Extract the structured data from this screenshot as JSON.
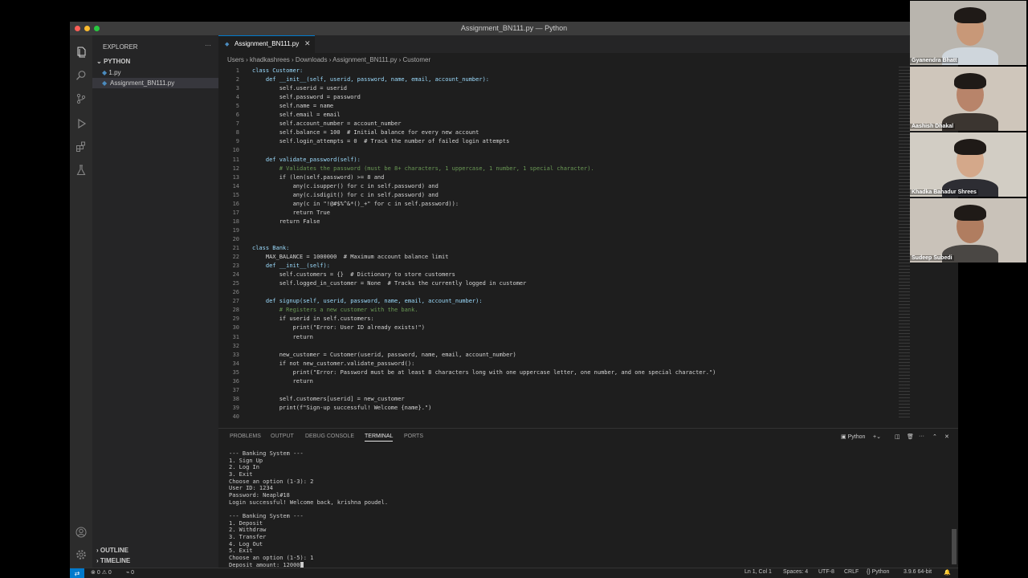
{
  "window": {
    "title": "Assignment_BN111.py — Python",
    "colors": {
      "close": "#ff5f57",
      "minimize": "#febc2e",
      "maximize": "#28c840",
      "accent": "#007acc"
    }
  },
  "sidebar": {
    "header": "EXPLORER",
    "more": "···",
    "folder": "PYTHON",
    "files": [
      "1.py",
      "Assignment_BN111.py"
    ],
    "outline": "OUTLINE",
    "timeline": "TIMELINE"
  },
  "editor": {
    "tab": "Assignment_BN111.py",
    "breadcrumb": [
      "Users",
      "khadkashrees",
      "Downloads",
      "Assignment_BN111.py",
      "Customer"
    ],
    "lines": [
      "class Customer:",
      "    def __init__(self, userid, password, name, email, account_number):",
      "        self.userid = userid",
      "        self.password = password",
      "        self.name = name",
      "        self.email = email",
      "        self.account_number = account_number",
      "        self.balance = 100  # Initial balance for every new account",
      "        self.login_attempts = 0  # Track the number of failed login attempts",
      "",
      "    def validate_password(self):",
      "        # Validates the password (must be 8+ characters, 1 uppercase, 1 number, 1 special character).",
      "        if (len(self.password) >= 8 and",
      "            any(c.isupper() for c in self.password) and",
      "            any(c.isdigit() for c in self.password) and",
      "            any(c in \"!@#$%^&*()_+\" for c in self.password)):",
      "            return True",
      "        return False",
      "",
      "",
      "class Bank:",
      "    MAX_BALANCE = 1000000  # Maximum account balance limit",
      "    def __init__(self):",
      "        self.customers = {}  # Dictionary to store customers",
      "        self.logged_in_customer = None  # Tracks the currently logged in customer",
      "",
      "    def signup(self, userid, password, name, email, account_number):",
      "        # Registers a new customer with the bank.",
      "        if userid in self.customers:",
      "            print(\"Error: User ID already exists!\")",
      "            return",
      "",
      "        new_customer = Customer(userid, password, name, email, account_number)",
      "        if not new_customer.validate_password():",
      "            print(\"Error: Password must be at least 8 characters long with one uppercase letter, one number, and one special character.\")",
      "            return",
      "",
      "        self.customers[userid] = new_customer",
      "        print(f\"Sign-up successful! Welcome {name}.\")",
      ""
    ]
  },
  "panel": {
    "tabs": [
      "PROBLEMS",
      "OUTPUT",
      "DEBUG CONSOLE",
      "TERMINAL",
      "PORTS"
    ],
    "active_tab": "TERMINAL",
    "shell": "Python",
    "terminal_lines": [
      "--- Banking System ---",
      "1. Sign Up",
      "2. Log In",
      "3. Exit",
      "Choose an option (1-3): 2",
      "User ID: 1234",
      "Password: Neapl#18",
      "Login successful! Welcome back, krishna poudel.",
      "",
      "--- Banking System ---",
      "1. Deposit",
      "2. Withdraw",
      "3. Transfer",
      "4. Log Out",
      "5. Exit",
      "Choose an option (1-5): 1",
      "Deposit amount: 12000"
    ]
  },
  "statusbar": {
    "errors": "0",
    "warnings": "0",
    "ports": "0",
    "position": "Ln 1, Col 1",
    "spaces": "Spaces: 4",
    "encoding": "UTF-8",
    "eol": "CRLF",
    "language": "Python",
    "interpreter": "3.9.6 64-bit"
  },
  "participants": [
    {
      "name": "Gyanendra Bhatt",
      "bg": "#b9b5ae",
      "skin": "#c89878",
      "shirt": "#cfd6dc"
    },
    {
      "name": "Aashish Dhakal",
      "bg": "#cfc6bb",
      "skin": "#b8846a",
      "shirt": "#3b3530"
    },
    {
      "name": "Khadka Bahadur Shrees",
      "bg": "#d2cdc4",
      "skin": "#d4a88a",
      "shirt": "#2d2d33"
    },
    {
      "name": "Sudeep Subedi",
      "bg": "#c9c2b9",
      "skin": "#b07d60",
      "shirt": "#4a4744"
    }
  ]
}
